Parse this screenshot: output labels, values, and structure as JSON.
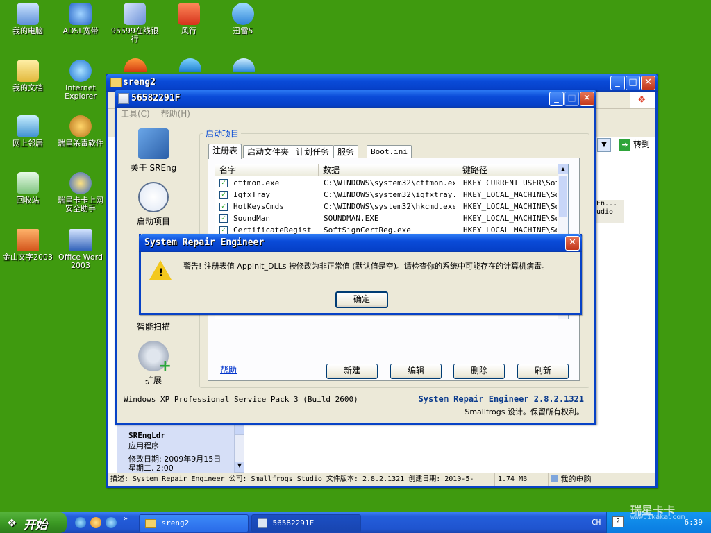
{
  "desktop": {
    "icons": [
      {
        "label": "我的电脑",
        "icon": "my-computer-icon"
      },
      {
        "label": "ADSL宽带",
        "icon": "adsl-icon"
      },
      {
        "label": "95599在线银行",
        "icon": "bank-icon"
      },
      {
        "label": "风行",
        "icon": "funshion-icon"
      },
      {
        "label": "迅雷5",
        "icon": "thunder-icon"
      },
      {
        "label": "我的文档",
        "icon": "my-documents-icon"
      },
      {
        "label": "Internet Explorer",
        "icon": "ie-icon"
      },
      {
        "label": "网上邻居",
        "icon": "network-icon"
      },
      {
        "label": "瑞星杀毒软件",
        "icon": "rising-icon"
      },
      {
        "label": "回收站",
        "icon": "recycle-bin-icon"
      },
      {
        "label": "瑞星卡卡上网安全助手",
        "icon": "kaka-icon"
      },
      {
        "label": "金山文字2003",
        "icon": "wps-icon"
      },
      {
        "label": "Office Word 2003",
        "icon": "word-icon"
      }
    ]
  },
  "explorer": {
    "title": "sreng2",
    "goto_label": "转到",
    "detail": {
      "name": "SREngLdr",
      "type": "应用程序",
      "modified": "修改日期: 2009年9月15日",
      "weekday": "星期二, 2:00"
    },
    "status_desc": "描述: System Repair Engineer 公司: Smallfrogs Studio 文件版本: 2.8.2.1321 创建日期: 2010-5-",
    "status_size": "1.74 MB",
    "status_zone": "我的电脑",
    "partial_text": "En...\nudio"
  },
  "sreng": {
    "title": "56582291F",
    "menu": [
      "工具(C)",
      "帮助(H)"
    ],
    "nav": [
      {
        "label": "关于 SREng",
        "icon": "tools-icon"
      },
      {
        "label": "启动项目",
        "icon": "clock-icon"
      },
      {
        "label": "智能扫描",
        "icon": "scan-icon"
      },
      {
        "label": "扩展",
        "icon": "gear-plus-icon"
      }
    ],
    "group_title": "启动项目",
    "tabs": [
      "注册表",
      "启动文件夹",
      "计划任务",
      "服务",
      "Boot.ini"
    ],
    "columns": [
      "名字",
      "数据",
      "键路径"
    ],
    "rows": [
      {
        "name": "ctfmon.exe",
        "data": "C:\\WINDOWS\\system32\\ctfmon.exe",
        "path": "HKEY_CURRENT_USER\\Soft"
      },
      {
        "name": "IgfxTray",
        "data": "C:\\WINDOWS\\system32\\igfxtray...",
        "path": "HKEY_LOCAL_MACHINE\\Sof"
      },
      {
        "name": "HotKeysCmds",
        "data": "C:\\WINDOWS\\system32\\hkcmd.exe",
        "path": "HKEY_LOCAL_MACHINE\\Sof"
      },
      {
        "name": "SoundMan",
        "data": "SOUNDMAN.EXE",
        "path": "HKEY_LOCAL_MACHINE\\Sof"
      },
      {
        "name": "CertificateRegist",
        "data": "SoftSignCertReg.exe",
        "path": "HKEY_LOCAL_MACHINE\\Sof"
      }
    ],
    "help_link": "帮助",
    "buttons": [
      "新建",
      "编辑",
      "删除",
      "刷新"
    ],
    "os_info": "Windows XP Professional Service Pack 3 (Build 2600)",
    "product": "System Repair Engineer 2.8.2.1321",
    "copyright": "Smallfrogs 设计。保留所有权利。"
  },
  "alert": {
    "title": "System Repair Engineer",
    "message": "警告! 注册表值 AppInit_DLLs 被修改为非正常值 (默认值是空)。请检查你的系统中可能存在的计算机病毒。",
    "ok_label": "确定"
  },
  "taskbar": {
    "start_label": "开始",
    "tasks": [
      "sreng2",
      "56582291F"
    ],
    "lang": "CH",
    "watermark": "瑞星卡卡",
    "watermark_url": "www.ikaka.com",
    "clock": "6:39"
  },
  "colors": {
    "desktop": "#3f9a0f",
    "title_blue": "#0a4bd8"
  }
}
